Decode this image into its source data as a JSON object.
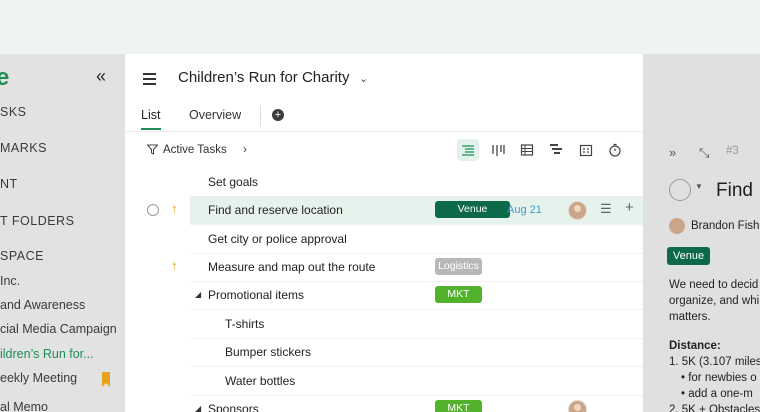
{
  "colors": {
    "accent": "#1d8f55",
    "venue_tag": "#0c6a4b",
    "logistics_tag": "#b8b8b8",
    "mkt_tag": "#52b22c",
    "date": "#3d9bcf",
    "priority": "#e3a41e",
    "bookmark": "#e7a21b"
  },
  "sidebar": {
    "logo": "e",
    "collapse_icon": "«",
    "items": [
      {
        "label": "SKS",
        "style": "caps"
      },
      {
        "label": "MARKS",
        "style": "caps"
      },
      {
        "label": "NT",
        "style": "caps"
      },
      {
        "label": "T FOLDERS",
        "style": "caps"
      },
      {
        "label": "SPACE",
        "style": "caps"
      },
      {
        "label": " Inc.",
        "style": ""
      },
      {
        "label": "and Awareness",
        "style": ""
      },
      {
        "label": "cial Media Campaign",
        "style": ""
      },
      {
        "label": "ildren’s Run for...",
        "style": "active"
      },
      {
        "label": "eekly Meeting",
        "style": ""
      },
      {
        "label": "al Memo",
        "style": ""
      }
    ]
  },
  "header": {
    "project_title": "Children’s Run for Charity",
    "chevron": "⌄"
  },
  "tabs": [
    {
      "label": "List",
      "active": true
    },
    {
      "label": "Overview",
      "active": false
    }
  ],
  "toolbar": {
    "filter_label": "Active Tasks",
    "views": [
      "list-view-icon",
      "board-view-icon",
      "table-view-icon",
      "gantt-view-icon",
      "calendar-view-icon",
      "timer-icon"
    ]
  },
  "tasks": [
    {
      "title": "Set goals",
      "indent": 0,
      "caret": false,
      "tag": "",
      "tag_color": "",
      "date": "",
      "priority": false,
      "selected": false
    },
    {
      "title": "Find and reserve location",
      "indent": 0,
      "caret": false,
      "tag": "Venue",
      "tag_color": "#0c6a4b",
      "date": "Aug 21",
      "priority": true,
      "selected": true
    },
    {
      "title": "Get city or police approval",
      "indent": 0,
      "caret": false,
      "tag": "",
      "tag_color": "",
      "date": "",
      "priority": false,
      "selected": false
    },
    {
      "title": "Measure and map out the route",
      "indent": 0,
      "caret": false,
      "tag": "Logistics",
      "tag_color": "#b8b8b8",
      "date": "",
      "priority": true,
      "selected": false
    },
    {
      "title": "Promotional items",
      "indent": 0,
      "caret": true,
      "tag": "MKT",
      "tag_color": "#52b22c",
      "date": "",
      "priority": false,
      "selected": false
    },
    {
      "title": "T-shirts",
      "indent": 1,
      "caret": false,
      "tag": "",
      "tag_color": "",
      "date": "",
      "priority": false,
      "selected": false
    },
    {
      "title": "Bumper stickers",
      "indent": 1,
      "caret": false,
      "tag": "",
      "tag_color": "",
      "date": "",
      "priority": false,
      "selected": false
    },
    {
      "title": "Water bottles",
      "indent": 1,
      "caret": false,
      "tag": "",
      "tag_color": "",
      "date": "",
      "priority": false,
      "selected": false
    },
    {
      "title": "Sponsors",
      "indent": 0,
      "caret": true,
      "tag": "MKT",
      "tag_color": "#52b22c",
      "date": "",
      "priority": false,
      "selected": false
    }
  ],
  "detail": {
    "number": "#3",
    "title": "Find",
    "assignee": "Brandon Fish",
    "tag": "Venue",
    "description": [
      "We need to decid",
      "organize, and whi",
      "matters."
    ],
    "section_heading": "Distance:",
    "list": [
      "1. 5K (3.107 miles",
      "• for newbies o",
      "• add a one-m",
      "2. 5K + Obstacles"
    ]
  }
}
